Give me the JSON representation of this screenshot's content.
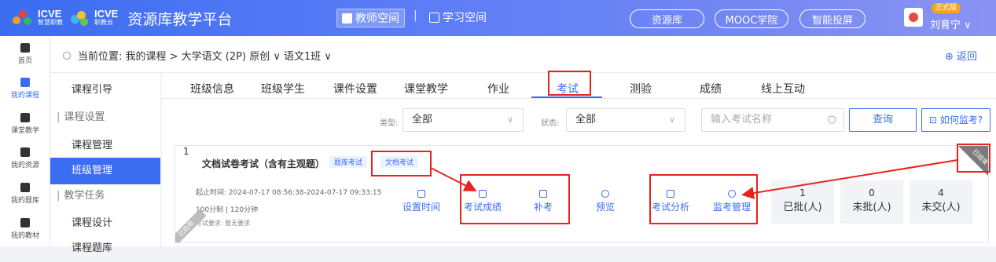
{
  "topbar": {
    "logo1_name": "ICVE",
    "logo1_sub": "智慧职教",
    "logo2_name": "ICVE",
    "logo2_sub": "职教云",
    "brand": "资源库教学平台",
    "teacher_space": "教师空间",
    "separator": "|",
    "student_space": "学习空间",
    "pills": [
      "资源库",
      "MOOC学院",
      "智能投屏"
    ],
    "vip_badge": "正式版",
    "user_name": "刘育宁 ∨"
  },
  "leftnav": [
    {
      "label": "首页"
    },
    {
      "label": "我的课程"
    },
    {
      "label": "课堂教学"
    },
    {
      "label": "我的资源"
    },
    {
      "label": "我的题库"
    },
    {
      "label": "我的教材"
    }
  ],
  "crumb": {
    "text": "当前位置: 我的课程 > 大学语文 (2P) 原创 ∨  语文1班 ∨",
    "back": "⊕ 返回"
  },
  "subnav": [
    {
      "label": "课程引导",
      "type": "item"
    },
    {
      "label": "课程设置",
      "type": "group"
    },
    {
      "label": "课程管理",
      "type": "item"
    },
    {
      "label": "班级管理",
      "type": "active"
    },
    {
      "label": "教学任务",
      "type": "group"
    },
    {
      "label": "课程设计",
      "type": "item"
    },
    {
      "label": "课程题库",
      "type": "item"
    }
  ],
  "tabs": [
    "班级信息",
    "班级学生",
    "课件设置",
    "课堂教学",
    "作业",
    "考试",
    "测验",
    "成绩",
    "线上互动"
  ],
  "filters": {
    "type_label": "类型:",
    "type_value": "全部",
    "status_label": "状态:",
    "status_value": "全部",
    "search_placeholder": "输入考试名称",
    "query_button": "查询",
    "howto_button": "⊡ 如何监考?"
  },
  "exam": {
    "index": "1",
    "title": "文档试卷考试（含有主观题）",
    "badge1": "题库考试",
    "badge2": "文档考试",
    "time": "起止时间: 2024-07-17 08:56:38-2024-07-17 09:33:15",
    "score": "100分制 | 120分钟",
    "requirement": "考试要求: 暂无要求",
    "ribbon": "已启用",
    "corner": "已结束",
    "actions": [
      "设置时间",
      "考试成绩",
      "补考",
      "预览",
      "考试分析",
      "监考管理"
    ],
    "stats": [
      {
        "num": "1",
        "label": "已批(人)"
      },
      {
        "num": "0",
        "label": "未批(人)"
      },
      {
        "num": "4",
        "label": "未交(人)"
      }
    ]
  },
  "colors": {
    "accent": "#3a6df0",
    "annotation": "#e8231d"
  }
}
